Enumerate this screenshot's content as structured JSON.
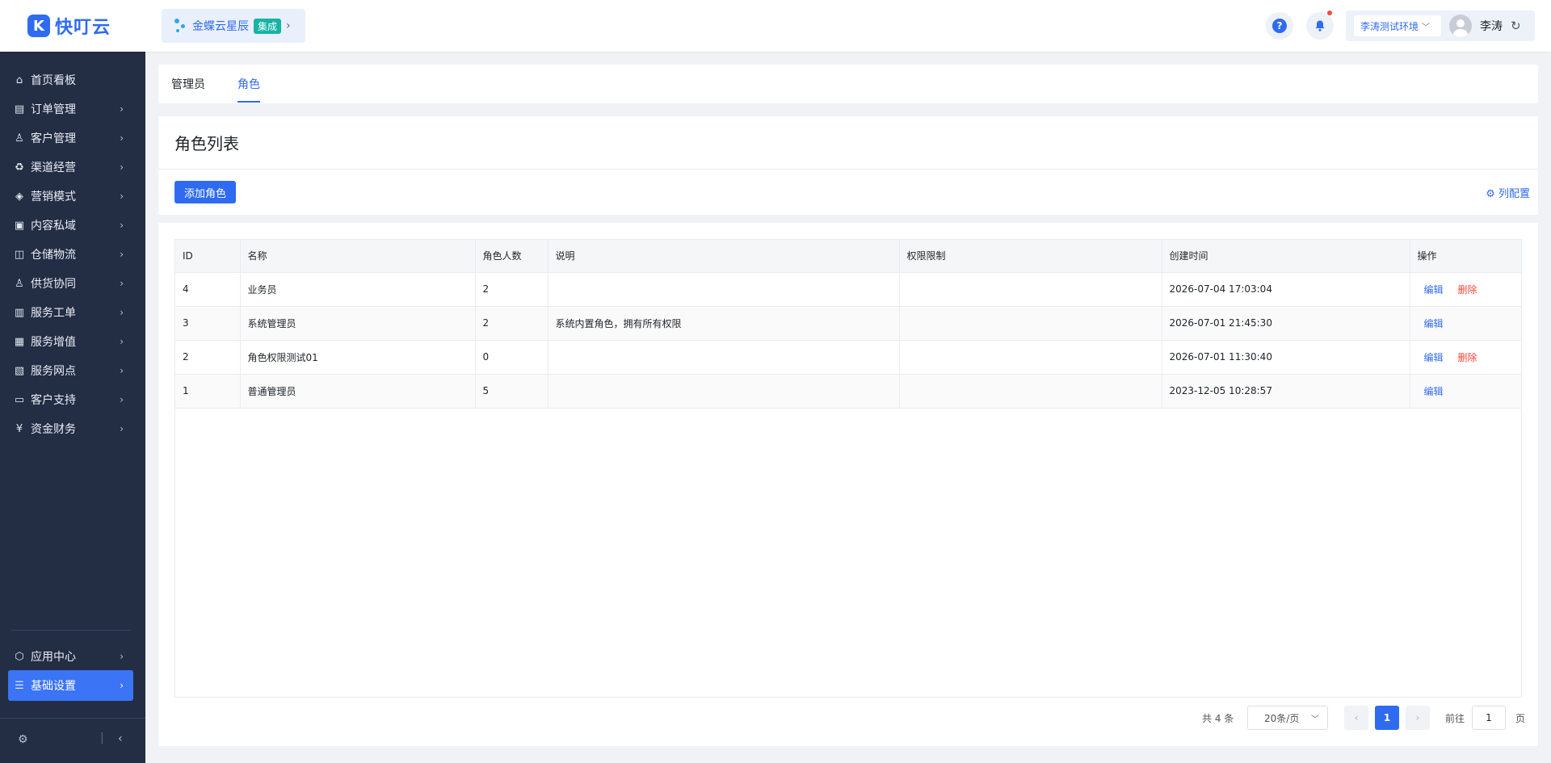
{
  "app": {
    "logo_glyph": "K",
    "logo_text": "快叮云"
  },
  "header": {
    "integration_name": "金蝶云星辰",
    "integration_badge": "集成",
    "help_icon_glyph": "?",
    "environment": "李涛测试环境",
    "username": "李涛"
  },
  "sidebar": {
    "items": [
      {
        "label": "首页看板",
        "icon": "home-icon",
        "arrow": false
      },
      {
        "label": "订单管理",
        "icon": "order-icon",
        "arrow": true
      },
      {
        "label": "客户管理",
        "icon": "customer-icon",
        "arrow": true
      },
      {
        "label": "渠道经营",
        "icon": "channel-icon",
        "arrow": true
      },
      {
        "label": "营销模式",
        "icon": "tag-icon",
        "arrow": true
      },
      {
        "label": "内容私域",
        "icon": "image-icon",
        "arrow": true
      },
      {
        "label": "仓储物流",
        "icon": "warehouse-icon",
        "arrow": true
      },
      {
        "label": "供货协同",
        "icon": "supply-icon",
        "arrow": true
      },
      {
        "label": "服务工单",
        "icon": "ticket-icon",
        "arrow": true
      },
      {
        "label": "服务增值",
        "icon": "bag-icon",
        "arrow": true
      },
      {
        "label": "服务网点",
        "icon": "store-icon",
        "arrow": true
      },
      {
        "label": "客户支持",
        "icon": "support-icon",
        "arrow": true
      },
      {
        "label": "资金财务",
        "icon": "yuan-icon",
        "arrow": true
      }
    ],
    "bottom_items": [
      {
        "label": "应用中心",
        "icon": "cube-icon",
        "active": false
      },
      {
        "label": "基础设置",
        "icon": "settings-list-icon",
        "active": true
      }
    ]
  },
  "tabs": [
    {
      "label": "管理员",
      "active": false
    },
    {
      "label": "角色",
      "active": true
    }
  ],
  "list": {
    "title": "角色列表",
    "add_button": "添加角色",
    "column_config": "列配置"
  },
  "table": {
    "columns": [
      "ID",
      "名称",
      "角色人数",
      "说明",
      "权限限制",
      "创建时间",
      "操作"
    ],
    "rows": [
      {
        "id": "4",
        "name": "业务员",
        "count": "2",
        "desc": "",
        "limit": "",
        "created": "2026-07-04 17:03:04",
        "edit": "编辑",
        "delete": "删除"
      },
      {
        "id": "3",
        "name": "系统管理员",
        "count": "2",
        "desc": "系统内置角色，拥有所有权限",
        "limit": "",
        "created": "2026-07-01 21:45:30",
        "edit": "编辑",
        "delete": ""
      },
      {
        "id": "2",
        "name": "角色权限测试01",
        "count": "0",
        "desc": "",
        "limit": "",
        "created": "2026-07-01 11:30:40",
        "edit": "编辑",
        "delete": "删除"
      },
      {
        "id": "1",
        "name": "普通管理员",
        "count": "5",
        "desc": "",
        "limit": "",
        "created": "2023-12-05 10:28:57",
        "edit": "编辑",
        "delete": ""
      }
    ]
  },
  "pagination": {
    "total": "共 4 条",
    "page_size": "20条/页",
    "current_page": "1",
    "goto_label": "前往",
    "goto_value": "1",
    "page_unit": "页"
  },
  "colors": {
    "primary": "#2f6bf0",
    "sidebar_bg": "#232d44",
    "danger": "#f5483b",
    "badge": "#17b3a5"
  }
}
